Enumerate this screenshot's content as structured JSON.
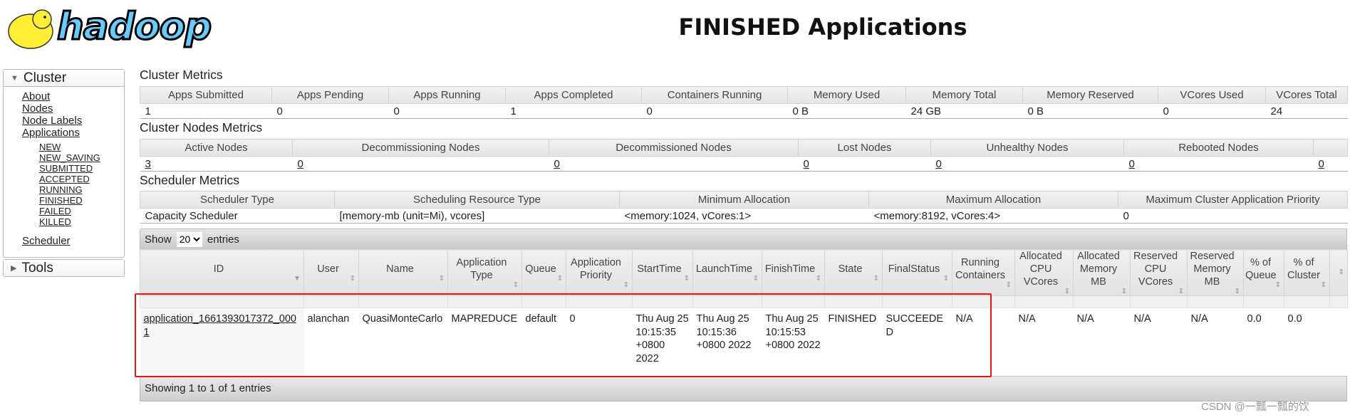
{
  "header": {
    "logo_text": "hadoop",
    "title": "FINISHED Applications"
  },
  "sidebar": {
    "cluster_label": "Cluster",
    "links": [
      "About",
      "Nodes",
      "Node Labels",
      "Applications"
    ],
    "app_states": [
      "NEW",
      "NEW_SAVING",
      "SUBMITTED",
      "ACCEPTED",
      "RUNNING",
      "FINISHED",
      "FAILED",
      "KILLED"
    ],
    "scheduler": "Scheduler",
    "tools_label": "Tools"
  },
  "cluster_metrics": {
    "title": "Cluster Metrics",
    "headers": [
      "Apps Submitted",
      "Apps Pending",
      "Apps Running",
      "Apps Completed",
      "Containers Running",
      "Memory Used",
      "Memory Total",
      "Memory Reserved",
      "VCores Used",
      "VCores Total"
    ],
    "values": [
      "1",
      "0",
      "0",
      "1",
      "0",
      "0 B",
      "24 GB",
      "0 B",
      "0",
      "24"
    ]
  },
  "nodes_metrics": {
    "title": "Cluster Nodes Metrics",
    "headers": [
      "Active Nodes",
      "Decommissioning Nodes",
      "Decommissioned Nodes",
      "Lost Nodes",
      "Unhealthy Nodes",
      "Rebooted Nodes",
      ""
    ],
    "values": [
      "3",
      "0",
      "0",
      "0",
      "0",
      "0",
      "0"
    ]
  },
  "scheduler_metrics": {
    "title": "Scheduler Metrics",
    "headers": [
      "Scheduler Type",
      "Scheduling Resource Type",
      "Minimum Allocation",
      "Maximum Allocation",
      "Maximum Cluster Application Priority"
    ],
    "values": [
      "Capacity Scheduler",
      "[memory-mb (unit=Mi), vcores]",
      "<memory:1024, vCores:1>",
      "<memory:8192, vCores:4>",
      "0"
    ]
  },
  "apps_table": {
    "show_label": "Show",
    "entries_label": "entries",
    "page_size": "20",
    "headers": [
      "ID",
      "User",
      "Name",
      "Application Type",
      "Queue",
      "Application Priority",
      "StartTime",
      "LaunchTime",
      "FinishTime",
      "State",
      "FinalStatus",
      "Running Containers",
      "Allocated CPU VCores",
      "Allocated Memory MB",
      "Reserved CPU VCores",
      "Reserved Memory MB",
      "% of Queue",
      "% of Cluster",
      ""
    ],
    "rows": [
      [
        "application_1661393017372_0001",
        "alanchan",
        "QuasiMonteCarlo",
        "MAPREDUCE",
        "default",
        "0",
        "Thu Aug 25 10:15:35 +0800 2022",
        "Thu Aug 25 10:15:36 +0800 2022",
        "Thu Aug 25 10:15:53 +0800 2022",
        "FINISHED",
        "SUCCEEDED",
        "N/A",
        "N/A",
        "N/A",
        "N/A",
        "N/A",
        "0.0",
        "0.0",
        ""
      ]
    ],
    "footer": "Showing 1 to 1 of 1 entries"
  },
  "watermark": "CSDN @一瓢一瓢的饮"
}
